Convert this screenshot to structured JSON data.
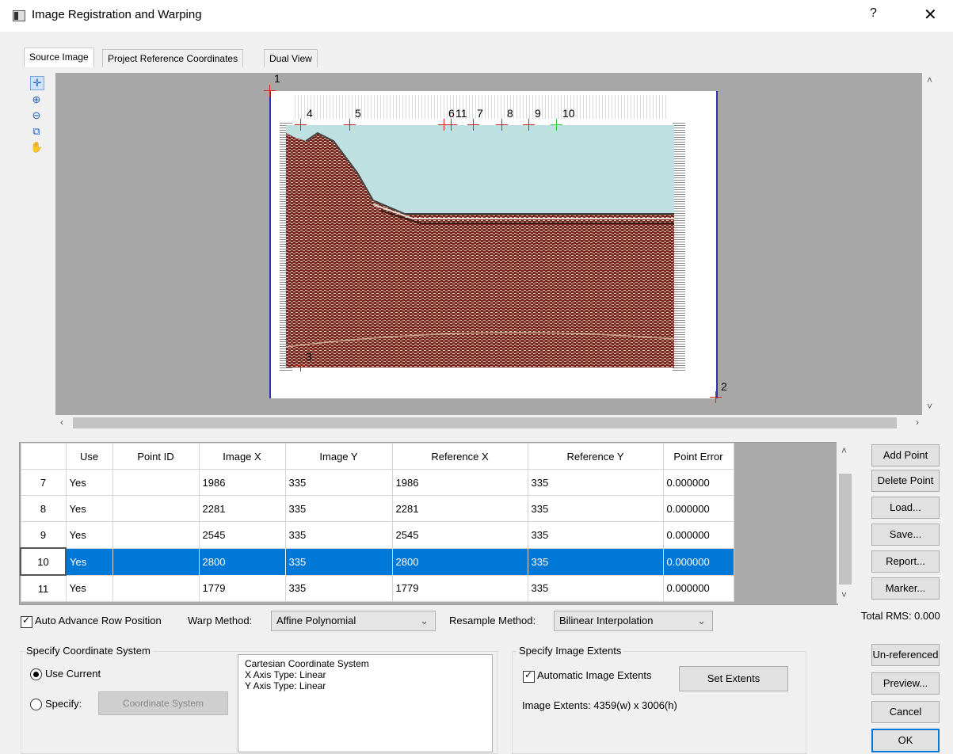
{
  "window": {
    "title": "Image Registration and Warping",
    "help": "?",
    "close": "✕"
  },
  "tabs": [
    "Source Image",
    "Project Reference Coordinates",
    "Dual View"
  ],
  "point_labels": [
    "1",
    "2",
    "3",
    "4",
    "5",
    "6",
    "11",
    "7",
    "8",
    "9",
    "10"
  ],
  "table": {
    "headers": [
      "Use",
      "Point ID",
      "Image X",
      "Image Y",
      "Reference X",
      "Reference Y",
      "Point Error"
    ],
    "rows": [
      {
        "n": "7",
        "use": "Yes",
        "id": "",
        "ix": "1986",
        "iy": "335",
        "rx": "1986",
        "ry": "335",
        "err": "0.000000"
      },
      {
        "n": "8",
        "use": "Yes",
        "id": "",
        "ix": "2281",
        "iy": "335",
        "rx": "2281",
        "ry": "335",
        "err": "0.000000"
      },
      {
        "n": "9",
        "use": "Yes",
        "id": "",
        "ix": "2545",
        "iy": "335",
        "rx": "2545",
        "ry": "335",
        "err": "0.000000"
      },
      {
        "n": "10",
        "use": "Yes",
        "id": "",
        "ix": "2800",
        "iy": "335",
        "rx": "2800",
        "ry": "335",
        "err": "0.000000"
      },
      {
        "n": "11",
        "use": "Yes",
        "id": "",
        "ix": "1779",
        "iy": "335",
        "rx": "1779",
        "ry": "335",
        "err": "0.000000"
      }
    ],
    "selected_row": "10"
  },
  "buttons": {
    "add_point": "Add Point",
    "delete_point": "Delete Point",
    "load": "Load...",
    "save": "Save...",
    "report": "Report...",
    "marker": "Marker...",
    "unreferenced": "Un-referenced",
    "preview": "Preview...",
    "cancel": "Cancel",
    "ok": "OK",
    "coordinate_system": "Coordinate System",
    "set_extents": "Set Extents"
  },
  "total_rms": "Total RMS: 0.000",
  "options": {
    "auto_advance": "Auto Advance Row Position",
    "warp_label": "Warp Method:",
    "warp_value": "Affine Polynomial",
    "resample_label": "Resample Method:",
    "resample_value": "Bilinear Interpolation"
  },
  "coord": {
    "group_label": "Specify Coordinate System",
    "use_current": "Use Current",
    "specify": "Specify:",
    "info": [
      "Cartesian Coordinate System",
      "X Axis Type: Linear",
      "Y Axis Type: Linear"
    ]
  },
  "extents": {
    "group_label": "Specify Image Extents",
    "auto": "Automatic Image Extents",
    "value": "Image Extents: 4359(w) x 3006(h)"
  },
  "colors": {
    "selection": "#0078d7",
    "marker": "#e02020",
    "active_marker": "#33cc33",
    "water": "#bfe0e0"
  }
}
